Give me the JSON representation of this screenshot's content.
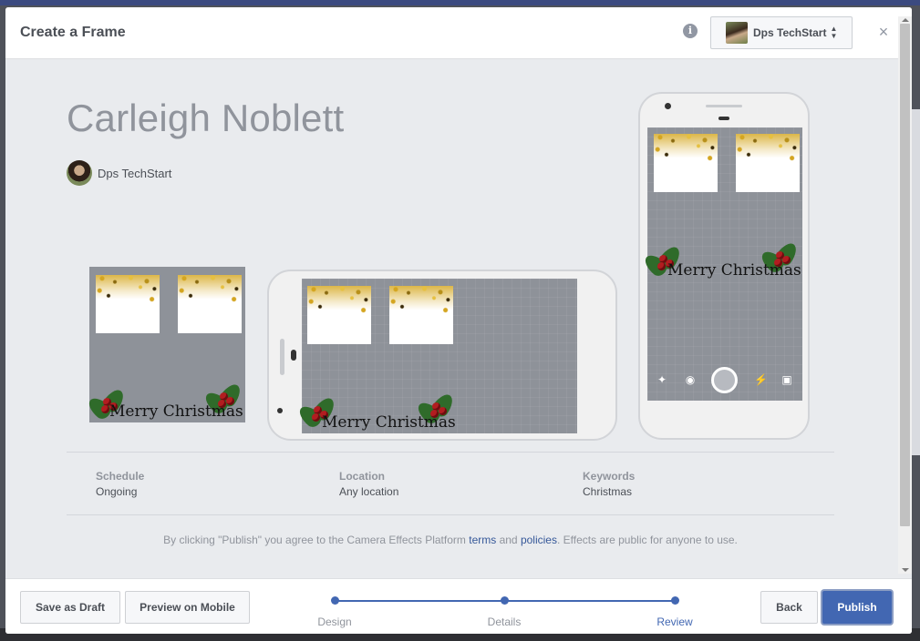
{
  "modal": {
    "title": "Create a Frame",
    "info_icon": "info-icon",
    "close_icon": "close-icon",
    "page_selector": {
      "label": "Dps TechStart",
      "icon": "sort-caret-icon"
    }
  },
  "frame": {
    "name": "Carleigh Noblett",
    "owner": "Dps TechStart",
    "overlay_text": "Merry Christmas"
  },
  "details": [
    {
      "label": "Schedule",
      "value": "Ongoing"
    },
    {
      "label": "Location",
      "value": "Any location"
    },
    {
      "label": "Keywords",
      "value": "Christmas"
    }
  ],
  "legal": {
    "prefix": "By clicking \"Publish\" you agree to the Camera Effects Platform",
    "terms_link": "terms",
    "and": "and",
    "policies_link": "policies",
    "suffix": ". Effects are public for anyone to use."
  },
  "footer": {
    "save_draft": "Save as Draft",
    "preview_mobile": "Preview on Mobile",
    "steps": [
      {
        "label": "Design",
        "active": false
      },
      {
        "label": "Details",
        "active": false
      },
      {
        "label": "Review",
        "active": true
      }
    ],
    "back": "Back",
    "publish": "Publish"
  },
  "colors": {
    "accent": "#4267b2",
    "link": "#365899",
    "frame_bg": "#8e9299",
    "berry": "#b21d20",
    "leaf": "#2f6b2a",
    "glitter": "#d4a520"
  }
}
